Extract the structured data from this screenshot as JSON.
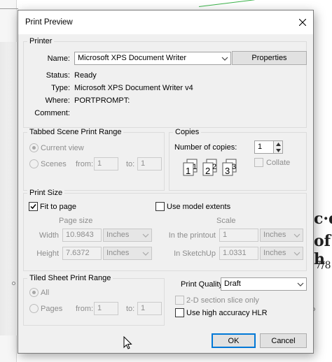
{
  "window": {
    "title": "Print Preview"
  },
  "printer": {
    "legend": "Printer",
    "name_label": "Name:",
    "name_value": "Microsoft XPS Document Writer",
    "properties_label": "Properties",
    "status_label": "Status:",
    "status_value": "Ready",
    "type_label": "Type:",
    "type_value": "Microsoft XPS Document Writer v4",
    "where_label": "Where:",
    "where_value": "PORTPROMPT:",
    "comment_label": "Comment:"
  },
  "scene_range": {
    "legend": "Tabbed Scene Print Range",
    "current_view_label": "Current view",
    "scenes_label": "Scenes",
    "from_label": "from:",
    "from_value": "1",
    "to_label": "to:",
    "to_value": "1"
  },
  "copies": {
    "legend": "Copies",
    "number_label": "Number of copies:",
    "number_value": "1",
    "collate_label": "Collate",
    "collate_pages": [
      "1",
      "2",
      "3"
    ],
    "collate_subpages": [
      "1",
      "2",
      "3"
    ]
  },
  "print_size": {
    "legend": "Print Size",
    "fit_to_page_label": "Fit to page",
    "model_extents_label": "Use model extents",
    "page_size_header": "Page size",
    "scale_header": "Scale",
    "width_label": "Width",
    "width_value": "10.9843",
    "width_unit": "Inches",
    "height_label": "Height",
    "height_value": "7.6372",
    "height_unit": "Inches",
    "printout_label": "In the printout",
    "printout_value": "1",
    "printout_unit": "Inches",
    "sketchup_label": "In SketchUp",
    "sketchup_value": "1.0331",
    "sketchup_unit": "Inches"
  },
  "tiled_range": {
    "legend": "Tiled Sheet Print Range",
    "all_label": "All",
    "pages_label": "Pages",
    "from_label": "from:",
    "from_value": "1",
    "to_label": "to:",
    "to_value": "1"
  },
  "quality": {
    "label": "Print Quality",
    "value": "Draft",
    "section_slice_label": "2-D section slice only",
    "hlr_label": "Use high accuracy HLR"
  },
  "buttons": {
    "ok": "OK",
    "cancel": "Cancel"
  },
  "background": {
    "text_1": "c·d",
    "text_2": "of h",
    "text_3": "7/8"
  },
  "colors": {
    "accent": "#0078d7",
    "dialog_bg": "#f0f0f0",
    "disabled_text": "#8d8d8d"
  }
}
